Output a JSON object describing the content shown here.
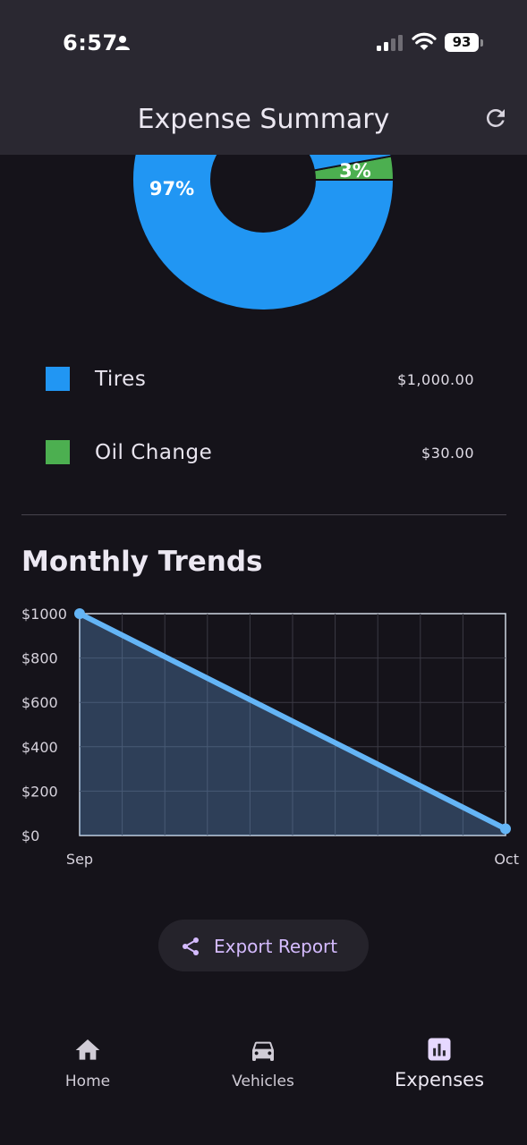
{
  "status_bar": {
    "time": "6:57",
    "battery": "93"
  },
  "app_bar": {
    "title": "Expense Summary",
    "refresh_icon": "refresh-icon"
  },
  "colors": {
    "tires": "#2196f3",
    "oil_change": "#4caf50",
    "line": "#64b5f6",
    "accent": "#d5bbff"
  },
  "expenses": [
    {
      "label": "Tires",
      "value": "$1,000.00",
      "amount": 1000,
      "percent_label": "97%",
      "color": "#2196f3"
    },
    {
      "label": "Oil Change",
      "value": "$30.00",
      "amount": 30,
      "percent_label": "3%",
      "color": "#4caf50"
    }
  ],
  "trends": {
    "title": "Monthly Trends"
  },
  "chart_data": {
    "type": "line",
    "x": [
      "Sep",
      "Oct"
    ],
    "y": [
      1000,
      30
    ],
    "yticks": [
      "$0",
      "$200",
      "$400",
      "$600",
      "$800",
      "$1000"
    ],
    "ylim": [
      0,
      1000
    ],
    "grid": true,
    "filled": true
  },
  "export": {
    "label": "Export Report",
    "icon": "share-icon"
  },
  "nav": {
    "items": [
      {
        "label": "Home",
        "icon": "home-icon",
        "active": false
      },
      {
        "label": "Vehicles",
        "icon": "car-icon",
        "active": false
      },
      {
        "label": "Expenses",
        "icon": "bar-chart-icon",
        "active": true
      }
    ]
  }
}
